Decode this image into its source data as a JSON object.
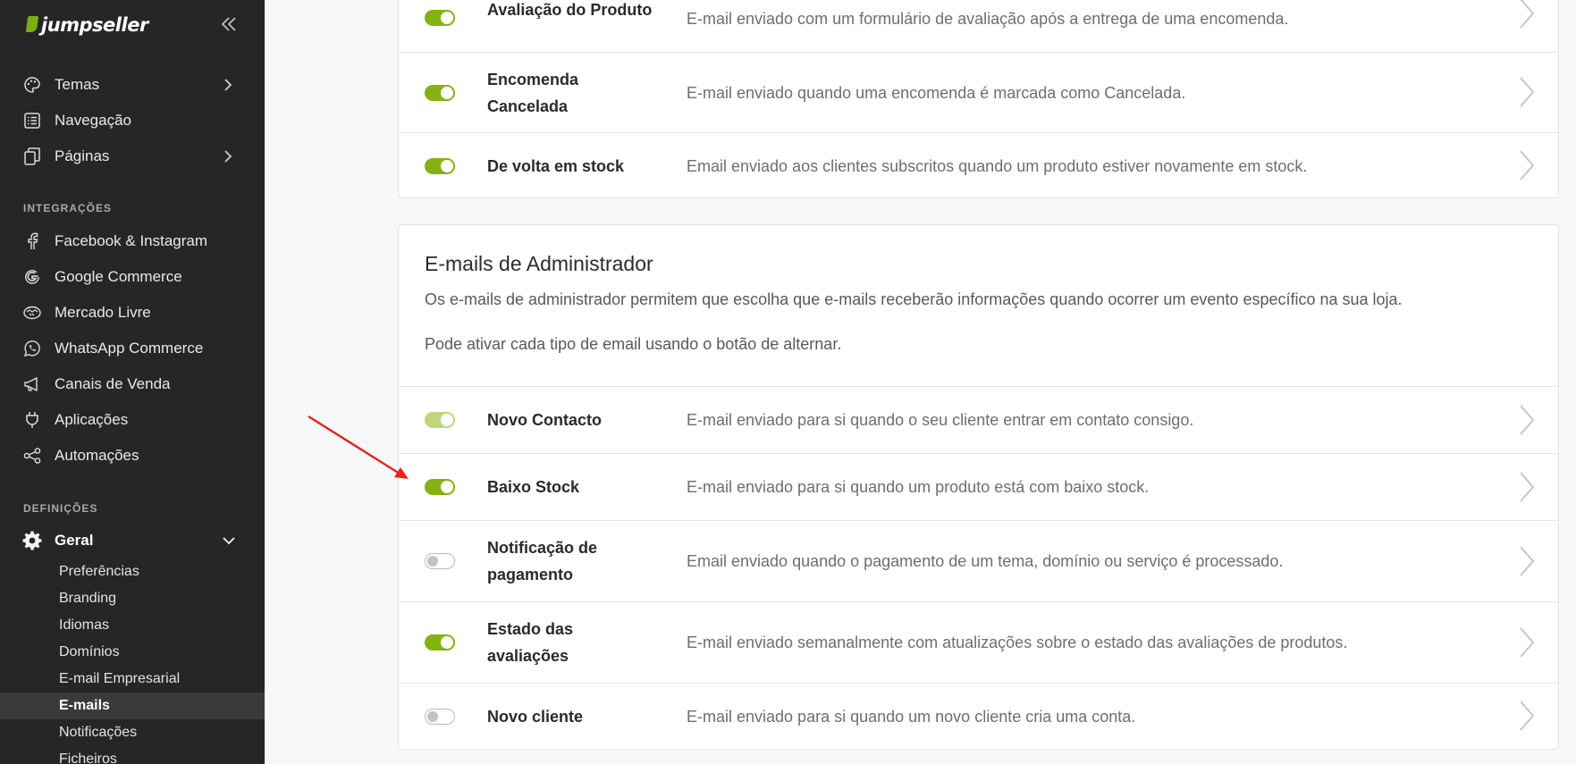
{
  "sidebar": {
    "logo": "jumpseller",
    "items": [
      {
        "label": "Temas",
        "icon": "palette-icon",
        "has_chevron": true
      },
      {
        "label": "Navegação",
        "icon": "list-icon",
        "has_chevron": false
      },
      {
        "label": "Páginas",
        "icon": "pages-icon",
        "has_chevron": true
      }
    ],
    "integrations_title": "INTEGRAÇÕES",
    "integrations": [
      {
        "label": "Facebook & Instagram",
        "icon": "facebook-icon"
      },
      {
        "label": "Google Commerce",
        "icon": "google-icon"
      },
      {
        "label": "Mercado Livre",
        "icon": "handshake-icon"
      },
      {
        "label": "WhatsApp Commerce",
        "icon": "whatsapp-icon"
      },
      {
        "label": "Canais de Venda",
        "icon": "megaphone-icon"
      },
      {
        "label": "Aplicações",
        "icon": "plug-icon"
      },
      {
        "label": "Automações",
        "icon": "share-nodes-icon"
      }
    ],
    "settings_title": "DEFINIÇÕES",
    "settings_main": {
      "label": "Geral",
      "icon": "gear-icon"
    },
    "sub_items": [
      "Preferências",
      "Branding",
      "Idiomas",
      "Domínios",
      "E-mail Empresarial",
      "E-mails",
      "Notificações",
      "Ficheiros"
    ],
    "active_sub": "E-mails"
  },
  "customer_rows": [
    {
      "name": "Avaliação do Produto",
      "desc": "E-mail enviado com um formulário de avaliação após a entrega de uma encomenda.",
      "state": "on"
    },
    {
      "name": "Encomenda Cancelada",
      "desc": "E-mail enviado quando uma encomenda é marcada como Cancelada.",
      "state": "on"
    },
    {
      "name": "De volta em stock",
      "desc": "Email enviado aos clientes subscritos quando um produto estiver novamente em stock.",
      "state": "on"
    }
  ],
  "admin": {
    "title": "E-mails de Administrador",
    "p1": "Os e-mails de administrador permitem que escolha que e-mails receberão informações quando ocorrer um evento específico na sua loja.",
    "p2": "Pode ativar cada tipo de email usando o botão de alternar.",
    "rows": [
      {
        "name": "Novo Contacto",
        "desc": "E-mail enviado para si quando o seu cliente entrar em contato consigo.",
        "state": "half"
      },
      {
        "name": "Baixo Stock",
        "desc": "E-mail enviado para si quando um produto está com baixo stock.",
        "state": "on"
      },
      {
        "name": "Notificação de pagamento",
        "desc": "Email enviado quando o pagamento de um tema, domínio ou serviço é processado.",
        "state": "off"
      },
      {
        "name": "Estado das avaliações",
        "desc": "E-mail enviado semanalmente com atualizações sobre o estado das avaliações de produtos.",
        "state": "on"
      },
      {
        "name": "Novo cliente",
        "desc": "E-mail enviado para si quando um novo cliente cria uma conta.",
        "state": "off"
      }
    ]
  },
  "colors": {
    "toggle_on": "#85b212",
    "toggle_half": "#bed77e",
    "sidebar_bg": "#262626",
    "annotation_arrow": "#e8211b"
  }
}
